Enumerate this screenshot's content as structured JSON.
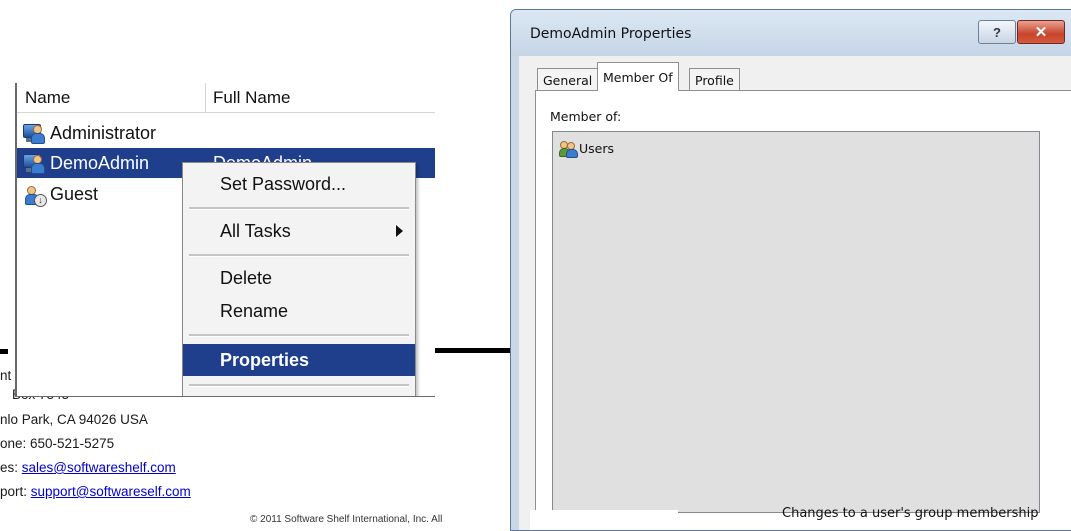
{
  "contact": {
    "line1": "nt",
    "line2": "Box 7343",
    "line3": "nlo Park, CA 94026 USA",
    "line4": "one: 650-521-5275",
    "sales_prefix": "es: ",
    "sales_email": "sales@softwareshelf.com",
    "support_prefix": "port: ",
    "support_email": "support@softwareself.com",
    "copyright": "© 2011 Software Shelf International, Inc. All"
  },
  "users_list": {
    "columns": [
      "Name",
      "Full Name"
    ],
    "rows": [
      {
        "name": "Administrator",
        "full_name": "",
        "icon": "user-icon"
      },
      {
        "name": "DemoAdmin",
        "full_name": "DemoAdmin",
        "icon": "user-icon"
      },
      {
        "name": "Guest",
        "full_name": "",
        "icon": "guest-user-icon"
      }
    ],
    "selected_row": "DemoAdmin"
  },
  "context_menu": {
    "items": {
      "set_password": "Set Password...",
      "all_tasks": "All Tasks",
      "delete": "Delete",
      "rename": "Rename",
      "properties": "Properties"
    },
    "highlighted": "Properties"
  },
  "dialog": {
    "title": "DemoAdmin Properties",
    "help_button": "?",
    "close_button": "✕",
    "tabs": [
      "General",
      "Member Of",
      "Profile"
    ],
    "active_tab": "Member Of",
    "member_of_label": "Member of:",
    "groups": [
      "Users"
    ],
    "note": "Changes to a user's group membership"
  }
}
